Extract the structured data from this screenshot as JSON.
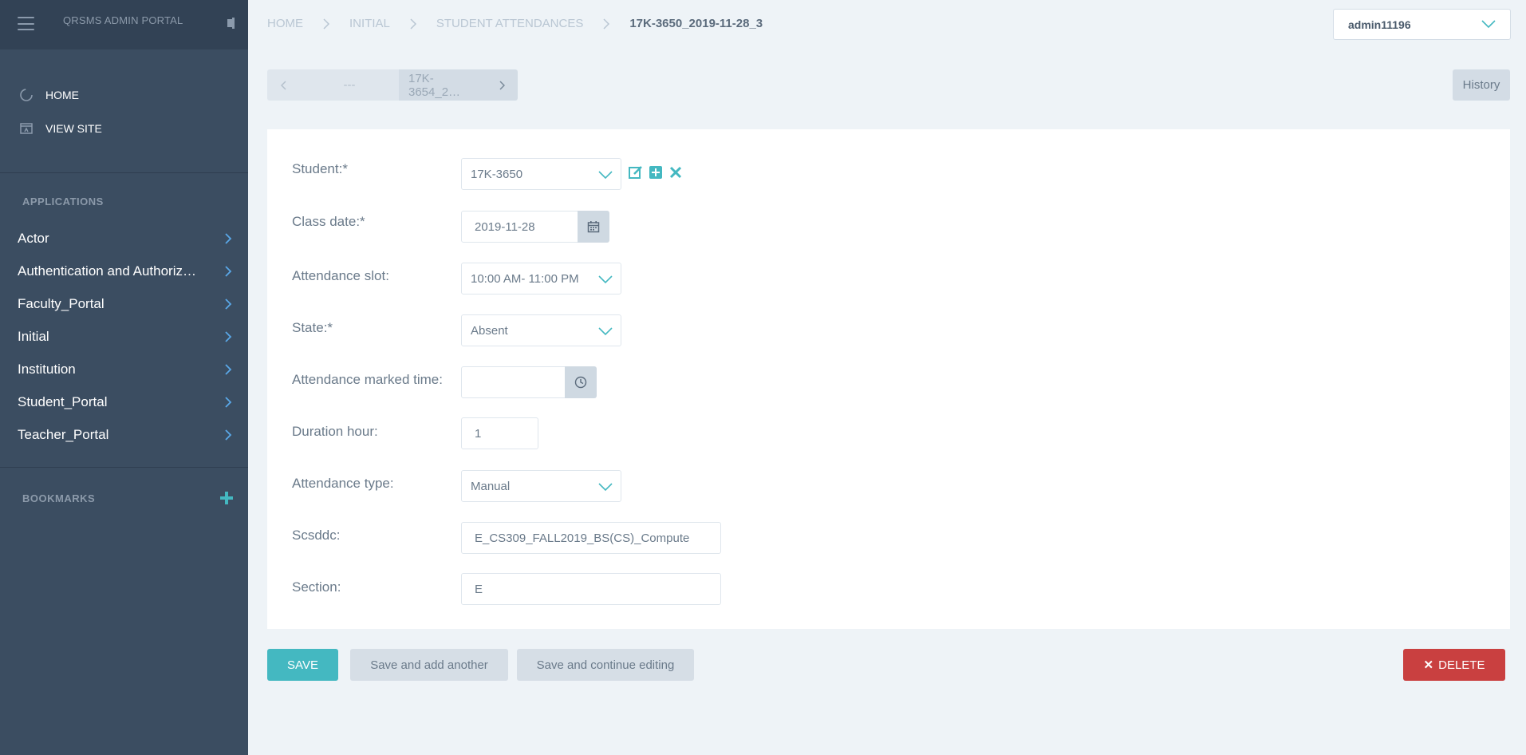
{
  "sidebar": {
    "brand": "QRSMS ADMIN PORTAL",
    "links": [
      {
        "label": "HOME",
        "icon": "home-circle-icon"
      },
      {
        "label": "VIEW SITE",
        "icon": "view-site-icon"
      }
    ],
    "applications_title": "APPLICATIONS",
    "apps": [
      {
        "label": "Actor"
      },
      {
        "label": "Authentication and Authoriz…"
      },
      {
        "label": "Faculty_Portal"
      },
      {
        "label": "Initial"
      },
      {
        "label": "Institution"
      },
      {
        "label": "Student_Portal"
      },
      {
        "label": "Teacher_Portal"
      }
    ],
    "bookmarks_title": "BOOKMARKS"
  },
  "breadcrumb": {
    "items": [
      "HOME",
      "INITIAL",
      "STUDENT ATTENDANCES"
    ],
    "current": "17K-3650_2019-11-28_3"
  },
  "user": {
    "name": "admin11196"
  },
  "pager": {
    "prev_label": "---",
    "next_label": "17K-3654_2…"
  },
  "history_label": "History",
  "form": {
    "student": {
      "label": "Student:*",
      "value": "17K-3650"
    },
    "class_date": {
      "label": "Class date:*",
      "value": "2019-11-28"
    },
    "attendance_slot": {
      "label": "Attendance slot:",
      "value": "10:00 AM- 11:00 PM"
    },
    "state": {
      "label": "State:*",
      "value": "Absent"
    },
    "attendance_marked_time": {
      "label": "Attendance marked time:",
      "value": ""
    },
    "duration_hour": {
      "label": "Duration hour:",
      "value": "1"
    },
    "attendance_type": {
      "label": "Attendance type:",
      "value": "Manual"
    },
    "scsddc": {
      "label": "Scsddc:",
      "value": "E_CS309_FALL2019_BS(CS)_Compute"
    },
    "section": {
      "label": "Section:",
      "value": "E"
    }
  },
  "buttons": {
    "save": "SAVE",
    "save_add": "Save and add another",
    "save_continue": "Save and continue editing",
    "delete": "DELETE"
  },
  "colors": {
    "sidebar_bg": "#3b4d61",
    "accent": "#44b8c1",
    "danger": "#c94040",
    "page_bg": "#eef3f7"
  }
}
